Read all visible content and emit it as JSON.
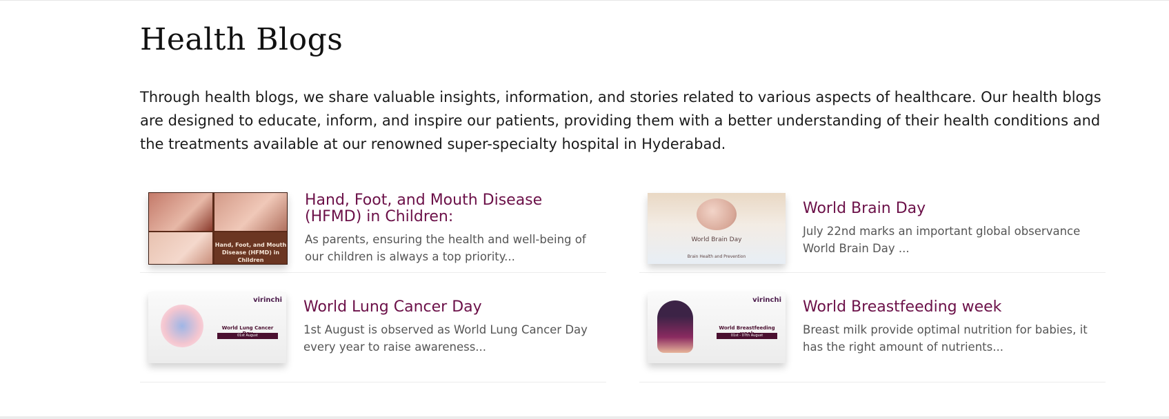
{
  "page": {
    "title": "Health Blogs",
    "intro": "Through health blogs, we share valuable insights, information, and stories related to various aspects of healthcare. Our health blogs are designed to educate, inform, and inspire our patients, providing them with a better understanding of their health conditions and the treatments available at our renowned super-specialty  hospital in Hyderabad."
  },
  "colors": {
    "title_accent": "#6b1048",
    "excerpt": "#555555"
  },
  "blogs": [
    {
      "title": "Hand, Foot, and Mouth Disease (HFMD) in Children:",
      "excerpt": "As parents, ensuring the health and well-being of our children is always a top priority...",
      "thumb_text": "Hand, Foot, and Mouth Disease (HFMD) in Children"
    },
    {
      "title": "World Brain Day",
      "excerpt": "July 22nd marks an important global observance World Brain Day ...",
      "thumb_text": "World Brain Day",
      "thumb_sub": "Brain Health and Prevention"
    },
    {
      "title": "World Lung Cancer Day",
      "excerpt": "1st August is observed as World Lung Cancer Day every year to raise awareness...",
      "thumb_logo": "virinchi",
      "thumb_text": "World Lung Cancer Day",
      "thumb_date": "01st August"
    },
    {
      "title": "World Breastfeeding week",
      "excerpt": "Breast milk provide optimal nutrition for babies, it has the right amount of nutrients...",
      "thumb_logo": "virinchi",
      "thumb_text": "World Breastfeeding week",
      "thumb_date": "01st - 07th August"
    }
  ]
}
